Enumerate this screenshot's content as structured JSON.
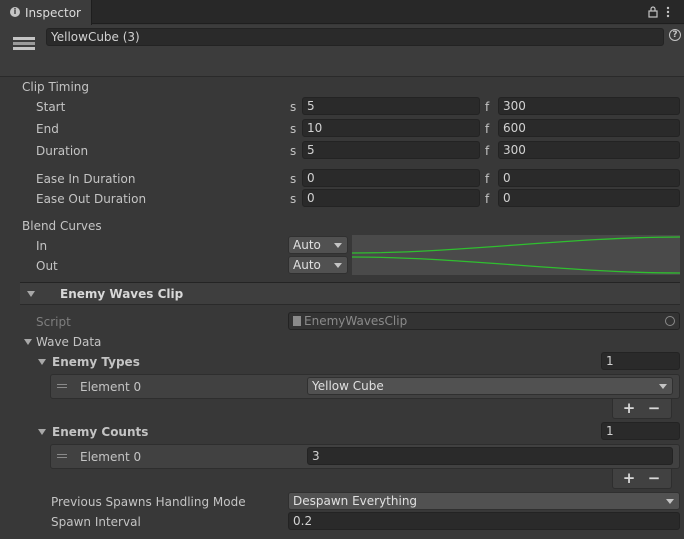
{
  "tab": {
    "icon": "info-icon",
    "title": "Inspector"
  },
  "header": {
    "icon": "cube-icon",
    "object_name": "YellowCube (3)"
  },
  "clip_timing": {
    "section_label": "Clip Timing",
    "seconds_unit": "s",
    "frames_unit": "f",
    "rows": [
      {
        "label": "Start",
        "seconds": "5",
        "frames": "300"
      },
      {
        "label": "End",
        "seconds": "10",
        "frames": "600"
      },
      {
        "label": "Duration",
        "seconds": "5",
        "frames": "300"
      },
      {
        "label": "Ease In Duration",
        "seconds": "0",
        "frames": "0"
      },
      {
        "label": "Ease Out Duration",
        "seconds": "0",
        "frames": "0"
      }
    ]
  },
  "blend_curves": {
    "section_label": "Blend Curves",
    "in_label": "In",
    "in_mode": "Auto",
    "out_label": "Out",
    "out_mode": "Auto",
    "curve_color": "#2fbf2f"
  },
  "component": {
    "title": "Enemy Waves Clip",
    "script_label": "Script",
    "script_value": "EnemyWavesClip"
  },
  "wave_data": {
    "label": "Wave Data",
    "enemy_types": {
      "label": "Enemy Types",
      "count": "1",
      "element_label": "Element 0",
      "element_value": "Yellow Cube"
    },
    "enemy_counts": {
      "label": "Enemy Counts",
      "count": "1",
      "element_label": "Element 0",
      "element_value": "3"
    },
    "add_symbol": "+",
    "remove_symbol": "−",
    "spawn_mode_label": "Previous Spawns Handling Mode",
    "spawn_mode_value": "Despawn Everything",
    "spawn_interval_label": "Spawn Interval",
    "spawn_interval_value": "0.2"
  }
}
